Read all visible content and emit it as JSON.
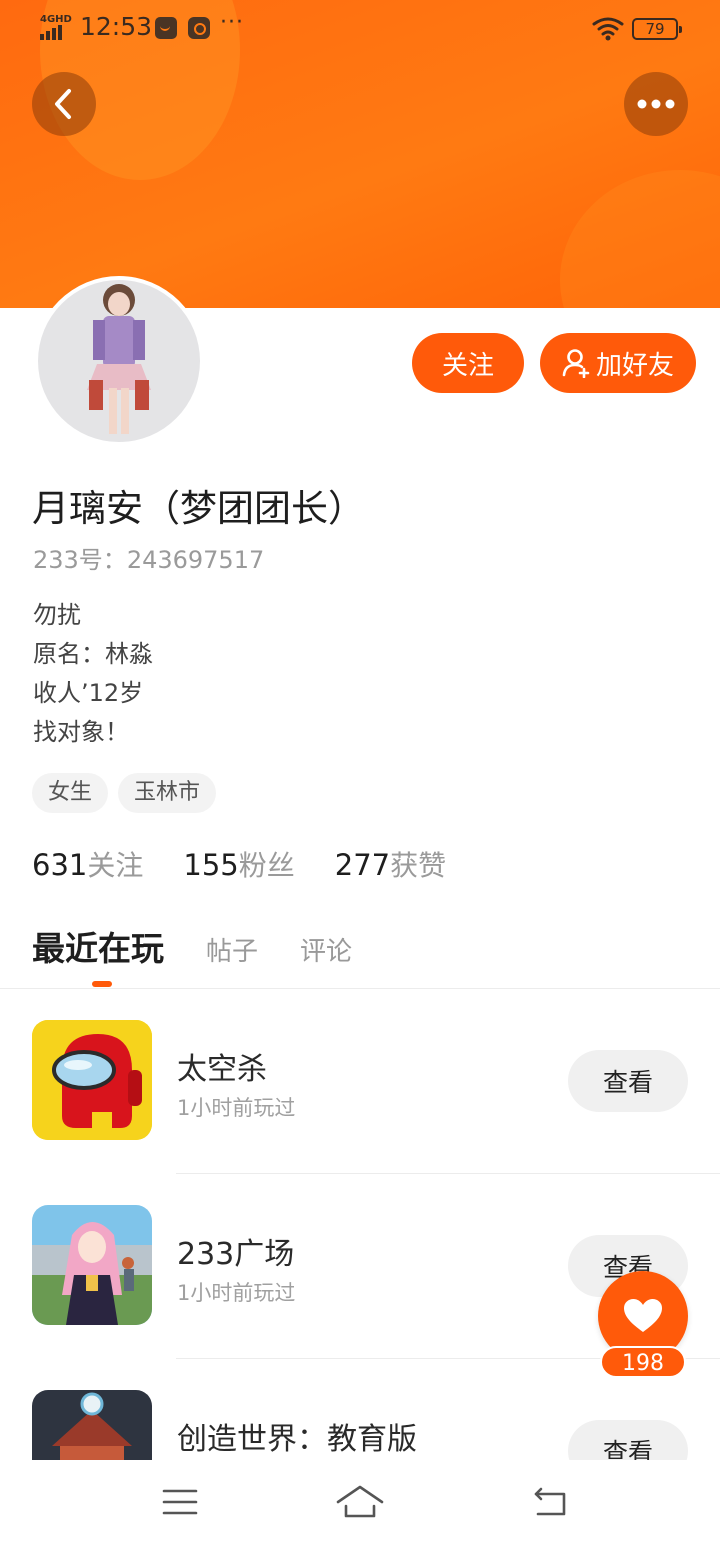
{
  "status_bar": {
    "network": "4GHD",
    "time": "12:53",
    "more": "···",
    "battery": "79",
    "icons": [
      "signal-icon",
      "mail-app-icon",
      "music-app-icon",
      "wifi-icon",
      "battery-icon"
    ]
  },
  "header": {
    "back_icon": "chevron-left-icon",
    "more_icon": "more-horizontal-icon",
    "accent_color": "#ff6a10"
  },
  "profile": {
    "name": "月璃安（梦团团长）",
    "id_label": "233号：",
    "id_value": "243697517",
    "bio": [
      "勿扰",
      "原名：林淼",
      "收人’12岁",
      "找对象！"
    ],
    "tags": [
      "女生",
      "玉林市"
    ],
    "follow_label": "关注",
    "add_friend_label": "加好友"
  },
  "stats": [
    {
      "num": "631",
      "label": "关注"
    },
    {
      "num": "155",
      "label": "粉丝"
    },
    {
      "num": "277",
      "label": "获赞"
    }
  ],
  "tabs": [
    {
      "label": "最近在玩",
      "active": true
    },
    {
      "label": "帖子",
      "active": false
    },
    {
      "label": "评论",
      "active": false
    }
  ],
  "games": [
    {
      "name": "太空杀",
      "sub": "1小时前玩过",
      "action": "查看"
    },
    {
      "name": "233广场",
      "sub": "1小时前玩过",
      "action": "查看"
    },
    {
      "name": "创造世界：教育版",
      "sub": "",
      "action": "查看"
    }
  ],
  "like": {
    "count": "198",
    "icon": "heart-icon"
  },
  "nav": {
    "icons": [
      "menu-icon",
      "home-icon",
      "back-icon"
    ]
  }
}
